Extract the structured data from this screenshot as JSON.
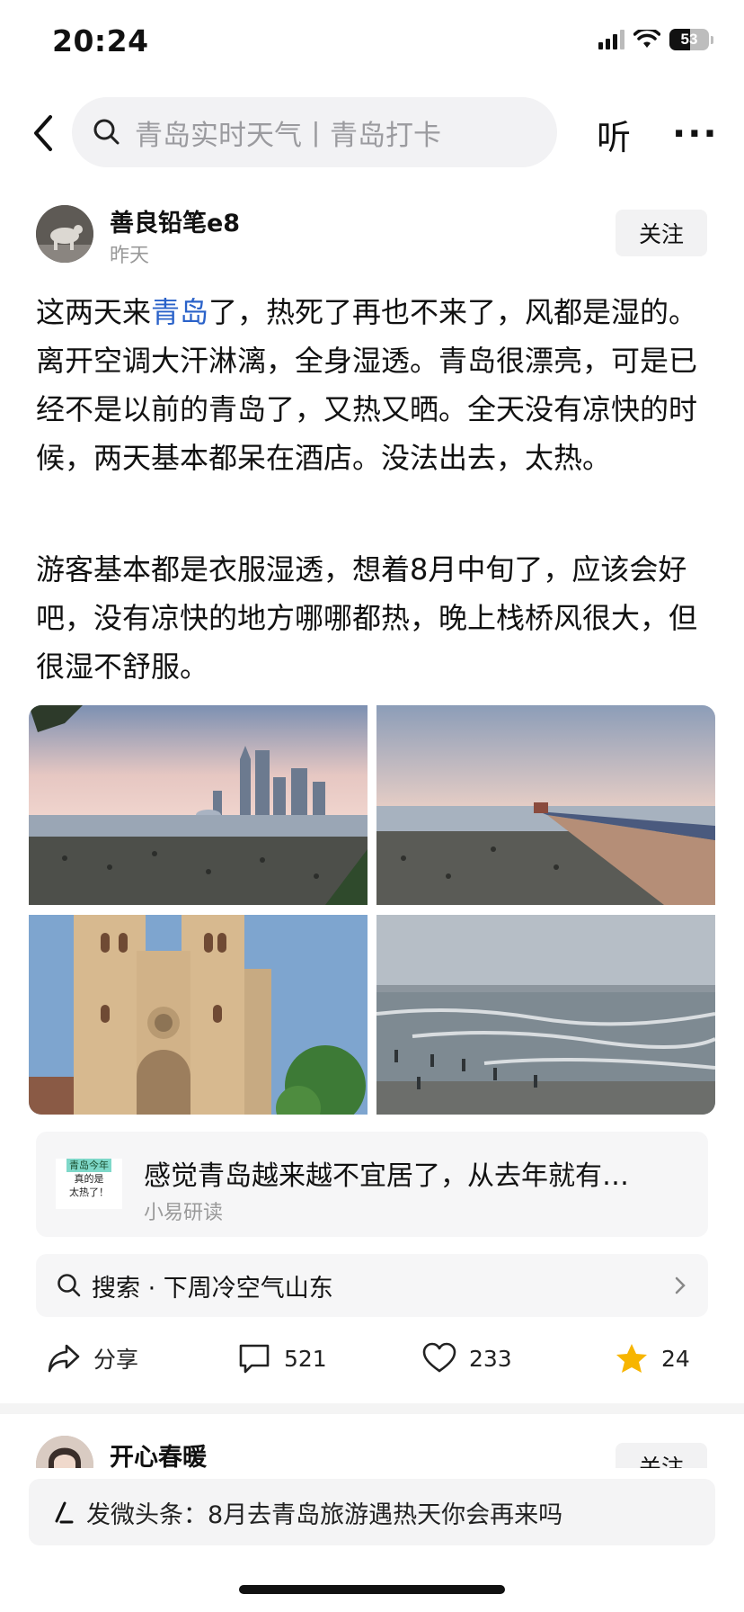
{
  "status_bar": {
    "time": "20:24",
    "battery": "53"
  },
  "nav": {
    "search_placeholder": "青岛实时天气丨青岛打卡",
    "listen_label": "听",
    "more_label": "···"
  },
  "post": {
    "author": "善良铅笔e8",
    "time": "昨天",
    "follow_label": "关注",
    "para1_a": "这两天来",
    "para1_link": "青岛",
    "para1_b": "了，热死了再也不来了，风都是湿的。离开空调大汗淋漓，全身湿透。青岛很漂亮，可是已经不是以前的青岛了，又热又晒。全天没有凉快的时候，两天基本都呆在酒店。没法出去，太热。",
    "para2": "游客基本都是衣服湿透，想着8月中旬了，应该会好吧，没有凉快的地方哪哪都热，晚上栈桥风很大，但很湿不舒服。",
    "photos": [
      "city-skyline-beach",
      "pier-crowd",
      "church",
      "waves-beach"
    ]
  },
  "related": {
    "thumb_line1": "青岛今年",
    "thumb_line2": "真的是",
    "thumb_line3": "太热了！",
    "title": "感觉青岛越来越不宜居了，从去年就有…",
    "source": "小易研读"
  },
  "suggest": {
    "text": "搜索 · 下周冷空气山东"
  },
  "actions": {
    "share_label": "分享",
    "comments": "521",
    "likes": "233",
    "favorites": "24"
  },
  "next_post": {
    "author": "开心春暖",
    "follow_label": "关注"
  },
  "composer": {
    "text": "发微头条：8月去青岛旅游遇热天你会再来吗"
  },
  "colors": {
    "link": "#2a62c9",
    "star": "#f7b500"
  }
}
